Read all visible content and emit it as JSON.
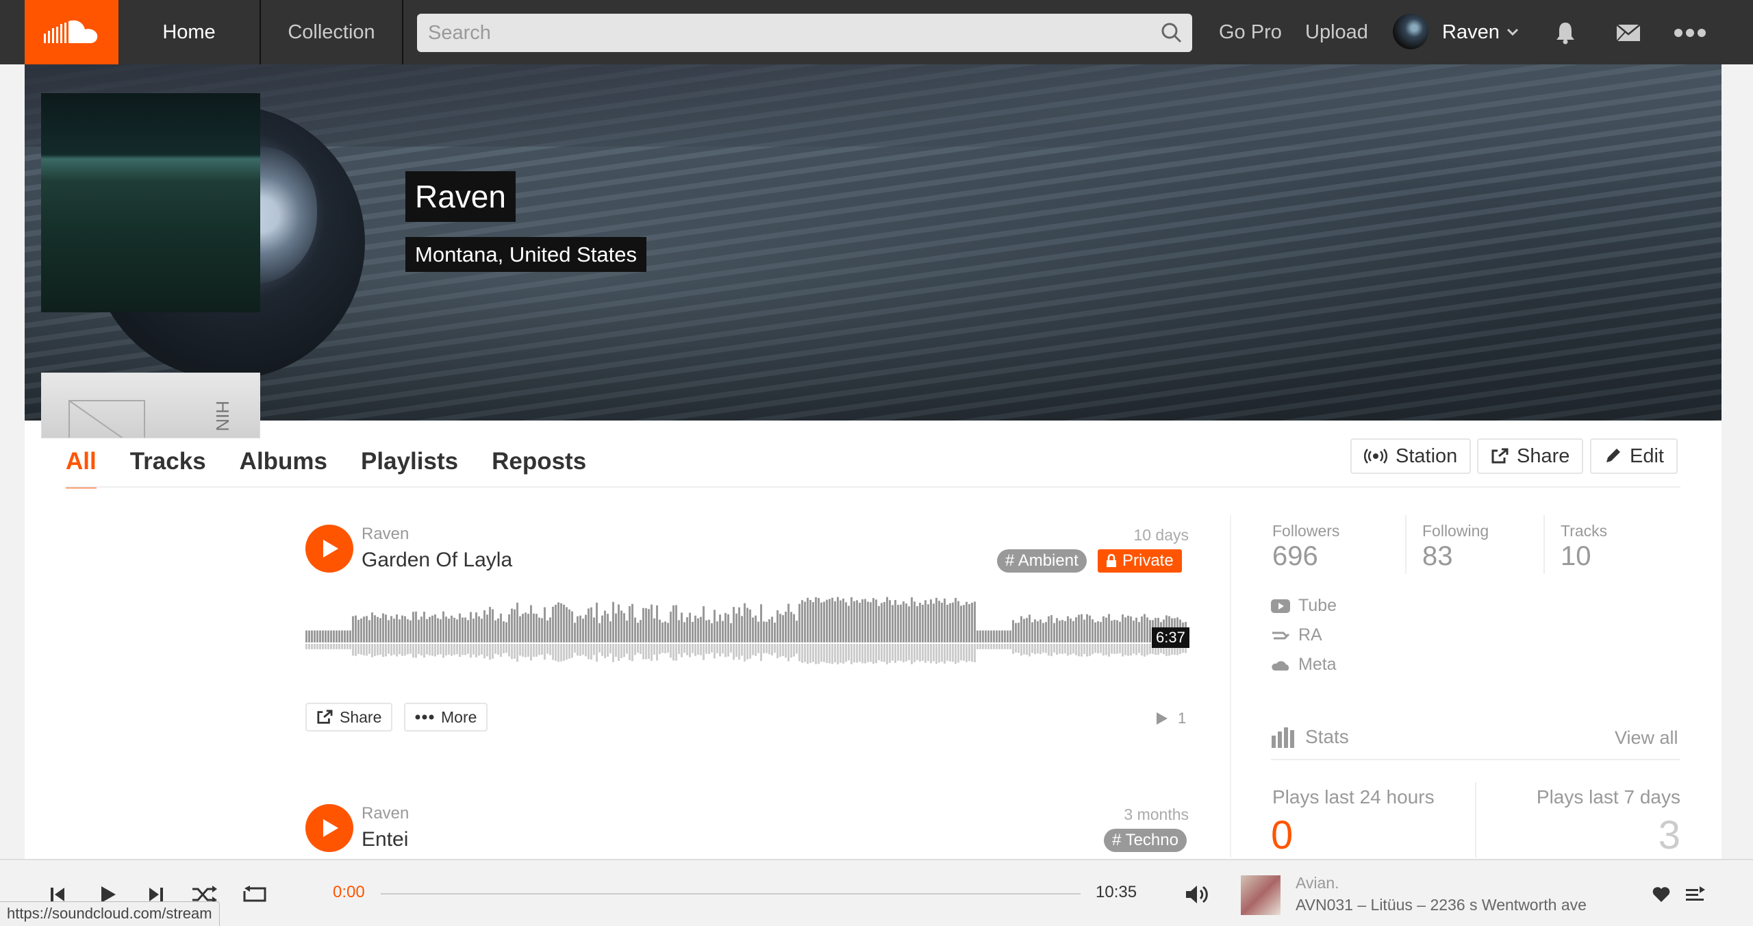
{
  "colors": {
    "accent": "#ff5500",
    "header_bg": "#333333",
    "tag_bg": "#999999"
  },
  "header": {
    "home": "Home",
    "collection": "Collection",
    "search_placeholder": "Search",
    "go_pro": "Go Pro",
    "upload": "Upload",
    "username": "Raven"
  },
  "profile": {
    "name": "Raven",
    "location": "Montana, United States"
  },
  "tabs": [
    "All",
    "Tracks",
    "Albums",
    "Playlists",
    "Reposts"
  ],
  "actions": {
    "station": "Station",
    "share": "Share",
    "edit": "Edit"
  },
  "tracks": [
    {
      "user": "Raven",
      "title": "Garden Of Layla",
      "date": "10 days",
      "tag": "# Ambient",
      "private": "Private",
      "duration": "6:37",
      "share": "Share",
      "more": "More",
      "plays": "1"
    },
    {
      "user": "Raven",
      "title": "Entei",
      "date": "3 months",
      "tag": "# Techno"
    }
  ],
  "sidebar": {
    "followers_label": "Followers",
    "followers": "696",
    "following_label": "Following",
    "following": "83",
    "tracks_label": "Tracks",
    "tracks": "10",
    "links": [
      "Tube",
      "RA",
      "Meta"
    ],
    "stats_label": "Stats",
    "view_all": "View all",
    "plays_24h_label": "Plays last 24 hours",
    "plays_24h": "0",
    "plays_7d_label": "Plays last 7 days",
    "plays_7d": "3"
  },
  "player": {
    "elapsed": "0:00",
    "total": "10:35",
    "artist": "Avian.",
    "title": "AVN031 – Litüus – 2236 s Wentworth ave"
  },
  "statusbar": "https://soundcloud.com/stream"
}
